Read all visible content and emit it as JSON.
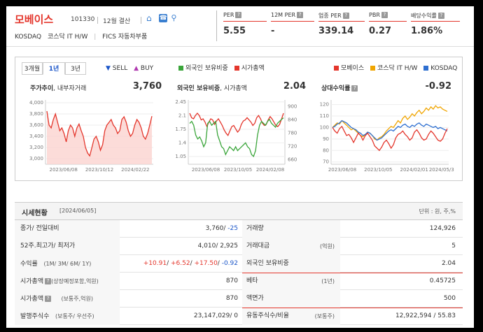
{
  "header": {
    "company_name": "모베이스",
    "code": "101330",
    "settlement": "12월 결산",
    "icons": [
      "home-icon",
      "phone-icon",
      "location-pin-icon"
    ],
    "market": "KOSDAQ",
    "sector": "코스닥 IT H/W",
    "fics": "FICS 자동차부품",
    "metrics": [
      {
        "label": "PER",
        "value": "5.55"
      },
      {
        "label": "12M PER",
        "value": "-"
      },
      {
        "label": "업종 PER",
        "value": "339.14"
      },
      {
        "label": "PBR",
        "value": "0.27"
      },
      {
        "label": "배당수익률",
        "value": "1.86%"
      }
    ]
  },
  "chart_controls": {
    "period_tabs": [
      "3개월",
      "1년",
      "3년"
    ],
    "active_period": "1년",
    "sell_label": "SELL",
    "buy_label": "BUY",
    "legend_mid": [
      {
        "name": "외국인 보유비중",
        "color": "#3aa53a"
      },
      {
        "name": "시가총액",
        "color": "#e4362c"
      }
    ],
    "legend_right": [
      {
        "name": "모베이스",
        "color": "#e4362c"
      },
      {
        "name": "코스닥 IT H/W",
        "color": "#f0a500"
      },
      {
        "name": "KOSDAQ",
        "color": "#2e6fd0"
      }
    ]
  },
  "chart_data": [
    {
      "type": "area",
      "title": "주가추이",
      "subtitle": "내부자거래",
      "current_value": "3,760",
      "y_ticks": [
        "4,000",
        "3,800",
        "3,600",
        "3,400",
        "3,200",
        "3,000"
      ],
      "x_ticks": [
        "2023/06/08",
        "2023/10/12",
        "2024/02/22"
      ],
      "ylim": [
        2900,
        4050
      ],
      "series": [
        {
          "values": [
            3850,
            3600,
            3550,
            3700,
            3800,
            3650,
            3500,
            3550,
            3450,
            3300,
            3500,
            3600,
            3550,
            3400,
            3550,
            3620,
            3500,
            3400,
            3200,
            3100,
            3050,
            3200,
            3350,
            3400,
            3300,
            3150,
            3250,
            3500,
            3600,
            3650,
            3700,
            3600,
            3550,
            3450,
            3500,
            3700,
            3750,
            3650,
            3500,
            3400,
            3450,
            3600,
            3700,
            3650,
            3550,
            3400,
            3350,
            3450,
            3600,
            3760
          ],
          "color": "#e4362c"
        }
      ]
    },
    {
      "type": "line",
      "title": "외국인 보유비중",
      "subtitle": "시가총액",
      "current_value": "2.04",
      "y_ticks_left": [
        "2.1",
        "1.75",
        "1.4",
        "1.05"
      ],
      "y_ticks_left_top": "2.45",
      "y_ticks_right": [
        "900",
        "840",
        "780",
        "720",
        "660"
      ],
      "x_ticks": [
        "2023/06/08",
        "2023/10/05",
        "2024/02/08"
      ],
      "series": [
        {
          "name": "외국인 보유비중",
          "color": "#3aa53a",
          "values": [
            1.9,
            1.95,
            1.85,
            1.6,
            1.5,
            1.55,
            1.45,
            1.3,
            1.4,
            1.9,
            1.95,
            1.85,
            1.9,
            1.95,
            1.6,
            1.45,
            1.3,
            1.25,
            1.1,
            1.2,
            1.3,
            1.25,
            1.2,
            1.3,
            1.2,
            1.25,
            1.3,
            1.35,
            1.4,
            1.3,
            1.25,
            1.1,
            1.05,
            1.2,
            1.6,
            1.85,
            1.95,
            1.9,
            1.85,
            1.95,
            2.0,
            1.9,
            1.85,
            1.8,
            1.9,
            1.95,
            2.0,
            2.04
          ]
        },
        {
          "name": "시가총액",
          "color": "#e4362c",
          "values": [
            870,
            850,
            845,
            860,
            870,
            860,
            840,
            845,
            830,
            810,
            830,
            845,
            840,
            820,
            835,
            845,
            830,
            815,
            795,
            780,
            770,
            790,
            810,
            815,
            800,
            785,
            795,
            820,
            835,
            840,
            850,
            840,
            830,
            815,
            825,
            850,
            860,
            845,
            825,
            815,
            820,
            840,
            855,
            845,
            830,
            815,
            810,
            820,
            845,
            870
          ]
        }
      ]
    },
    {
      "type": "line",
      "title": "상대수익률",
      "current_value": "-0.92",
      "y_ticks": [
        "120",
        "110",
        "100",
        "90",
        "80",
        "70"
      ],
      "x_ticks": [
        "2023/06/08",
        "2023/10/05",
        "2024/02/01",
        "2024/05/30"
      ],
      "ylim": [
        68,
        124
      ],
      "series": [
        {
          "name": "모베이스",
          "color": "#e4362c",
          "values": [
            100,
            97,
            95,
            99,
            101,
            97,
            93,
            94,
            91,
            87,
            91,
            95,
            93,
            89,
            93,
            95,
            92,
            89,
            84,
            82,
            80,
            83,
            87,
            89,
            86,
            82,
            85,
            91,
            94,
            95,
            97,
            94,
            92,
            89,
            91,
            96,
            98,
            95,
            91,
            89,
            90,
            94,
            97,
            95,
            92,
            89,
            88,
            90,
            95,
            99
          ]
        },
        {
          "name": "코스닥 IT H/W",
          "color": "#f0a500",
          "values": [
            100,
            102,
            104,
            103,
            106,
            104,
            102,
            100,
            98,
            99,
            97,
            95,
            93,
            92,
            94,
            96,
            95,
            93,
            90,
            89,
            91,
            92,
            94,
            97,
            99,
            101,
            100,
            103,
            106,
            104,
            108,
            110,
            107,
            109,
            112,
            110,
            113,
            115,
            112,
            114,
            117,
            115,
            118,
            116,
            119,
            117,
            118,
            116,
            115,
            114
          ]
        },
        {
          "name": "KOSDAQ",
          "color": "#2e6fd0",
          "values": [
            100,
            101,
            103,
            104,
            106,
            105,
            104,
            102,
            100,
            99,
            98,
            96,
            95,
            93,
            94,
            96,
            95,
            93,
            91,
            89,
            90,
            91,
            93,
            95,
            97,
            98,
            97,
            99,
            101,
            100,
            102,
            103,
            101,
            100,
            102,
            101,
            103,
            104,
            102,
            101,
            103,
            102,
            101,
            100,
            101,
            99,
            100,
            99,
            98,
            97
          ]
        }
      ]
    }
  ],
  "table": {
    "title": "시세현황",
    "date": "[2024/06/05]",
    "unit": "단위 : 원, 주,%",
    "rows": [
      {
        "l1": "종가/ 전일대비",
        "l1sub": "",
        "v1": "3,760/ ",
        "v1b": "-25",
        "l2": "거래량",
        "l2sub": "",
        "v2": "124,926"
      },
      {
        "l1": "52주.최고가/ 최저가",
        "l1sub": "",
        "v1": "4,010/ 2,925",
        "v1b": "",
        "l2": "거래대금",
        "l2sub": "(억원)",
        "v2": "5"
      },
      {
        "l1": "수익률",
        "l1sub": "(1M/ 3M/ 6M/ 1Y)",
        "returns": [
          "+10.91",
          "+6.52",
          "+17.50",
          "-0.92"
        ],
        "l2": "외국인 보유비중",
        "l2sub": "",
        "v2": "2.04"
      },
      {
        "l1": "시가총액",
        "l1sub": "(상장예정포함,억원)",
        "v1": "870",
        "v1b": "",
        "l2": "베타",
        "l2sub": "(1년)",
        "v2": "0.45725"
      },
      {
        "l1": "시가총액",
        "l1sub": "(보통주,억원)",
        "v1": "870",
        "v1b": "",
        "l2": "액면가",
        "l2sub": "",
        "v2": "500"
      },
      {
        "l1": "발행주식수",
        "l1sub": "(보통주/ 우선주)",
        "v1": "23,147,029/ 0",
        "v1b": "",
        "l2": "유동주식수/비율",
        "l2sub": "(보통주)",
        "v2": "12,922,594 / 55.83"
      }
    ]
  }
}
